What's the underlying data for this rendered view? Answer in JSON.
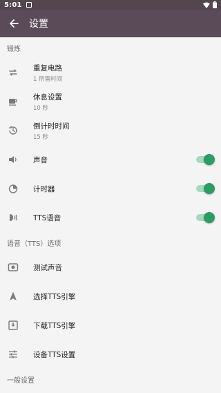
{
  "statusbar": {
    "time": "5:01"
  },
  "appbar": {
    "title": "设置",
    "back_icon": "arrow-left-icon"
  },
  "sections": {
    "workout": {
      "header": "锻炼",
      "items": [
        {
          "label": "重复电路",
          "sub": "1 所需时间",
          "icon": "repeat-icon"
        },
        {
          "label": "休息设置",
          "sub": "10 秒",
          "icon": "coffee-cup-icon"
        },
        {
          "label": "倒计时时间",
          "sub": "15 秒",
          "icon": "history-icon"
        },
        {
          "label": "声音",
          "icon": "speaker-icon",
          "toggle": true
        },
        {
          "label": "计时器",
          "icon": "timer-icon",
          "toggle": true
        },
        {
          "label": "TTS语音",
          "icon": "voice-icon",
          "toggle": true
        }
      ]
    },
    "tts": {
      "header": "语音（TTS）选项",
      "items": [
        {
          "label": "测试声音",
          "icon": "speaker-box-icon"
        },
        {
          "label": "选择TTS引擎",
          "icon": "navigation-arrow-icon"
        },
        {
          "label": "下载TTS引擎",
          "icon": "download-box-icon"
        },
        {
          "label": "设备TTS设置",
          "icon": "sliders-icon"
        }
      ]
    },
    "general": {
      "header": "一般设置"
    }
  },
  "colors": {
    "appbar": "#5b4b58",
    "statusbar": "#53464f",
    "toggle_on": "#2e9b63",
    "toggle_track": "#a7d9bf"
  }
}
